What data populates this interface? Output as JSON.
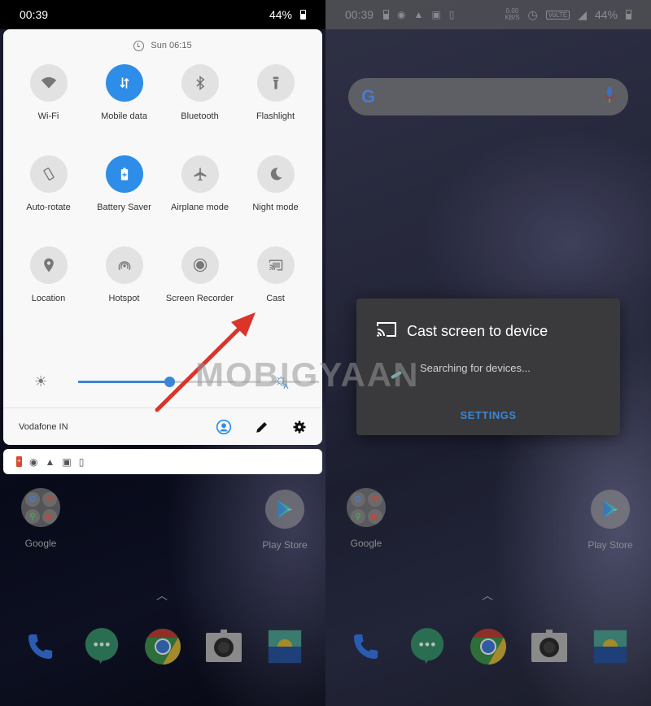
{
  "left_screen": {
    "status_bar": {
      "time": "00:39",
      "battery": "44%"
    },
    "quick_settings": {
      "alarm": "Sun 06:15",
      "tiles": [
        {
          "label": "Wi-Fi",
          "icon": "wifi-icon",
          "active": false
        },
        {
          "label": "Mobile data",
          "icon": "mobile-data-icon",
          "active": true
        },
        {
          "label": "Bluetooth",
          "icon": "bluetooth-icon",
          "active": false
        },
        {
          "label": "Flashlight",
          "icon": "flashlight-icon",
          "active": false
        },
        {
          "label": "Auto-rotate",
          "icon": "auto-rotate-icon",
          "active": false
        },
        {
          "label": "Battery Saver",
          "icon": "battery-saver-icon",
          "active": true
        },
        {
          "label": "Airplane mode",
          "icon": "airplane-icon",
          "active": false
        },
        {
          "label": "Night mode",
          "icon": "moon-icon",
          "active": false
        },
        {
          "label": "Location",
          "icon": "location-icon",
          "active": false
        },
        {
          "label": "Hotspot",
          "icon": "hotspot-icon",
          "active": false
        },
        {
          "label": "Screen Recorder",
          "icon": "screen-recorder-icon",
          "active": false
        },
        {
          "label": "Cast",
          "icon": "cast-icon",
          "active": false
        }
      ],
      "brightness": {
        "level": 0.38,
        "auto_label": "A"
      },
      "carrier": "Vodafone IN",
      "footer_icons": [
        "user-icon",
        "edit-icon",
        "settings-icon"
      ]
    },
    "notification_icons": [
      "battery-saver-icon",
      "data-saver-icon",
      "warning-icon",
      "image-icon",
      "phone-download-icon"
    ]
  },
  "right_screen": {
    "status_bar": {
      "time": "00:39",
      "speed": "0.00",
      "speed_unit": "KB/S",
      "volte": "VoLTE",
      "battery": "44%"
    },
    "search_bar": {
      "logo": "G"
    },
    "cast_dialog": {
      "title": "Cast screen to device",
      "status": "Searching for devices...",
      "settings_button": "SETTINGS"
    }
  },
  "home": {
    "apps": [
      {
        "label": "Google",
        "type": "folder",
        "folder_apps": [
          "G",
          "M",
          "⚲",
          "▶"
        ]
      },
      {
        "label": "Play Store",
        "type": "app"
      }
    ],
    "dock": [
      "Phone",
      "Messages",
      "Chrome",
      "Camera",
      "Gallery"
    ]
  },
  "watermark": "MOBIGYAAN",
  "colors": {
    "accent": "#2e8de8",
    "arrow": "#d9352a",
    "dialog": "#3a3a3c"
  }
}
